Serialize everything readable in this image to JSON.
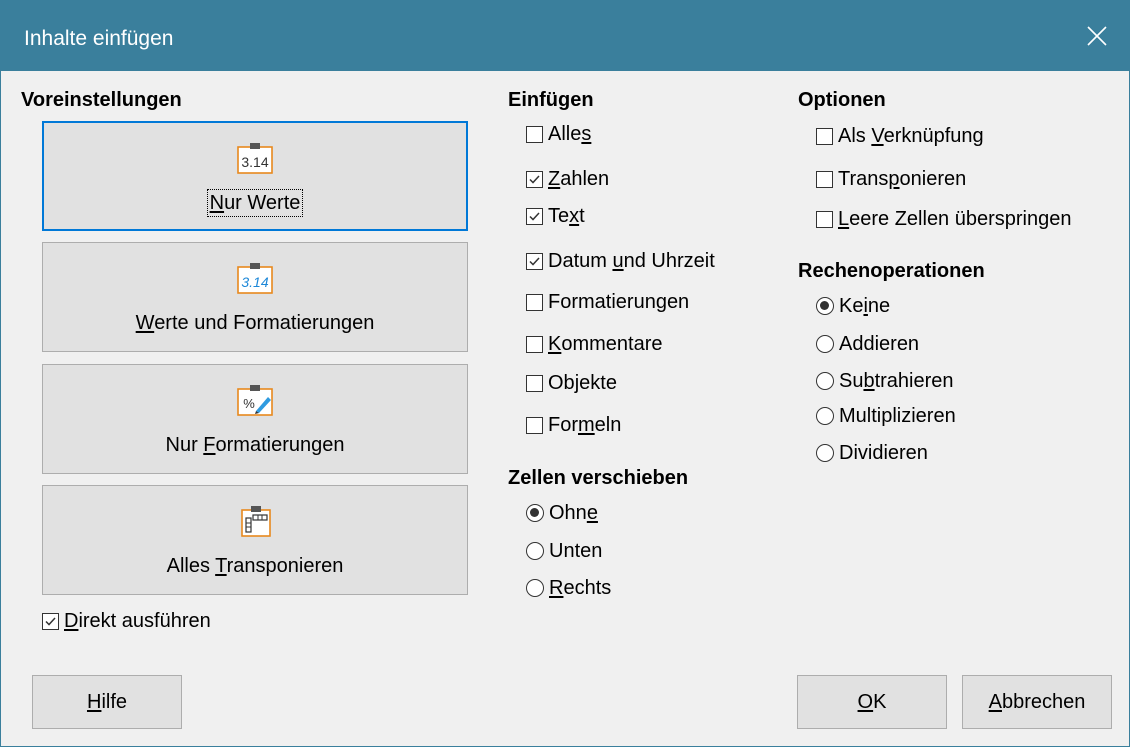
{
  "window": {
    "title": "Inhalte einfügen",
    "close_icon": "close-icon"
  },
  "presets": {
    "heading": "Voreinstellungen",
    "items": [
      {
        "pre": "",
        "key": "N",
        "post": "ur Werte",
        "icon": "values-only-icon",
        "focused": true
      },
      {
        "pre": "",
        "key": "W",
        "post": "erte und Formatierungen",
        "icon": "values-formats-icon"
      },
      {
        "pre": "Nur ",
        "key": "F",
        "post": "ormatierungen",
        "icon": "formats-only-icon"
      },
      {
        "pre": "Alles ",
        "key": "T",
        "post": "ransponieren",
        "icon": "transpose-all-icon"
      }
    ],
    "run_immediately": {
      "pre": "",
      "key": "D",
      "post": "irekt ausführen",
      "checked": true
    }
  },
  "insert": {
    "heading": "Einfügen",
    "items": [
      {
        "pre": "Alle",
        "key": "s",
        "post": "",
        "checked": false
      },
      {
        "pre": "",
        "key": "Z",
        "post": "ahlen",
        "checked": true
      },
      {
        "pre": "Te",
        "key": "x",
        "post": "t",
        "checked": true
      },
      {
        "pre": "Datum ",
        "key": "u",
        "post": "nd Uhrzeit",
        "checked": true
      },
      {
        "pre": "Formatierun",
        "key": "g",
        "post": "en",
        "checked": false
      },
      {
        "pre": "",
        "key": "K",
        "post": "ommentare",
        "checked": false
      },
      {
        "pre": "Ob",
        "key": "j",
        "post": "ekte",
        "checked": false
      },
      {
        "pre": "For",
        "key": "m",
        "post": "eln",
        "checked": false
      }
    ]
  },
  "shift": {
    "heading": "Zellen verschieben",
    "items": [
      {
        "pre": "Ohn",
        "key": "e",
        "post": "",
        "selected": true
      },
      {
        "pre": "Unten",
        "key": "",
        "post": "",
        "selected": false
      },
      {
        "pre": "",
        "key": "R",
        "post": "echts",
        "selected": false
      }
    ]
  },
  "options": {
    "heading": "Optionen",
    "items": [
      {
        "pre": "Als ",
        "key": "V",
        "post": "erknüpfung",
        "checked": false
      },
      {
        "pre": "Trans",
        "key": "p",
        "post": "onieren",
        "checked": false
      },
      {
        "pre": "",
        "key": "L",
        "post": "eere Zellen überspringen",
        "checked": false
      }
    ]
  },
  "operations": {
    "heading": "Rechenoperationen",
    "items": [
      {
        "pre": "Ke",
        "key": "i",
        "post": "ne",
        "selected": true
      },
      {
        "pre": "Addieren",
        "key": "",
        "post": "",
        "selected": false
      },
      {
        "pre": "Su",
        "key": "b",
        "post": "trahieren",
        "selected": false
      },
      {
        "pre": "Multiplizieren",
        "key": "",
        "post": "",
        "selected": false
      },
      {
        "pre": "Dividieren",
        "key": "",
        "post": "",
        "selected": false
      }
    ]
  },
  "buttons": {
    "help": {
      "pre": "",
      "key": "H",
      "post": "ilfe"
    },
    "ok": {
      "pre": "",
      "key": "O",
      "post": "K"
    },
    "cancel": {
      "pre": "",
      "key": "A",
      "post": "bbrechen"
    }
  }
}
